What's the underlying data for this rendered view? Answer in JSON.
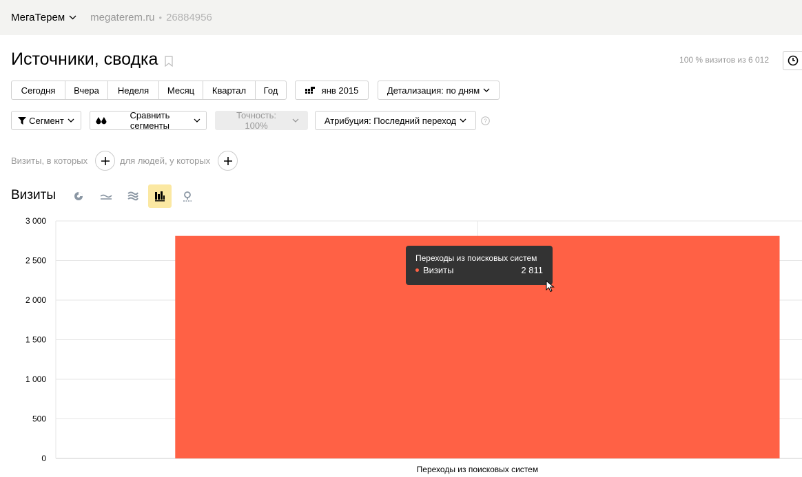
{
  "topbar": {
    "site_name": "МегаТерем",
    "site_url": "megaterem.ru",
    "separator": "•",
    "counter_id": "26884956"
  },
  "page": {
    "title": "Источники, сводка",
    "visits_share": "100 % визитов из 6 012"
  },
  "periods": [
    "Сегодня",
    "Вчера",
    "Неделя",
    "Месяц",
    "Квартал",
    "Год"
  ],
  "date_range": "янв 2015",
  "detail": "Детализация: по дням",
  "segment_label": "Сегмент",
  "compare_label": "Сравнить сегменты",
  "accuracy_label": "Точность: 100%",
  "attribution_label": "Атрибуция: Последний переход",
  "filters": {
    "visits_where": "Визиты, в которых",
    "people_where": "для людей, у которых"
  },
  "chart_section": {
    "title": "Визиты",
    "view_icons": [
      "pie-chart-icon",
      "line-chart-icon",
      "area-chart-icon",
      "bar-chart-icon",
      "map-icon"
    ],
    "active_view": "bar-chart-icon"
  },
  "colors": {
    "bar": "#ff6145",
    "active_view_bg": "#fbe8a2",
    "tooltip_bg": "#333333"
  },
  "chart_data": {
    "type": "bar",
    "categories": [
      "Переходы из поисковых систем"
    ],
    "series": [
      {
        "name": "Визиты",
        "values": [
          2811
        ]
      }
    ],
    "ylim": [
      0,
      3000
    ],
    "yticks": [
      0,
      500,
      1000,
      1500,
      2000,
      2500,
      3000
    ],
    "ytick_labels": [
      "0",
      "500",
      "1 000",
      "1 500",
      "2 000",
      "2 500",
      "3 000"
    ],
    "grid": true
  },
  "tooltip": {
    "title": "Переходы из поисковых систем",
    "series_name": "Визиты",
    "value": "2 811"
  }
}
